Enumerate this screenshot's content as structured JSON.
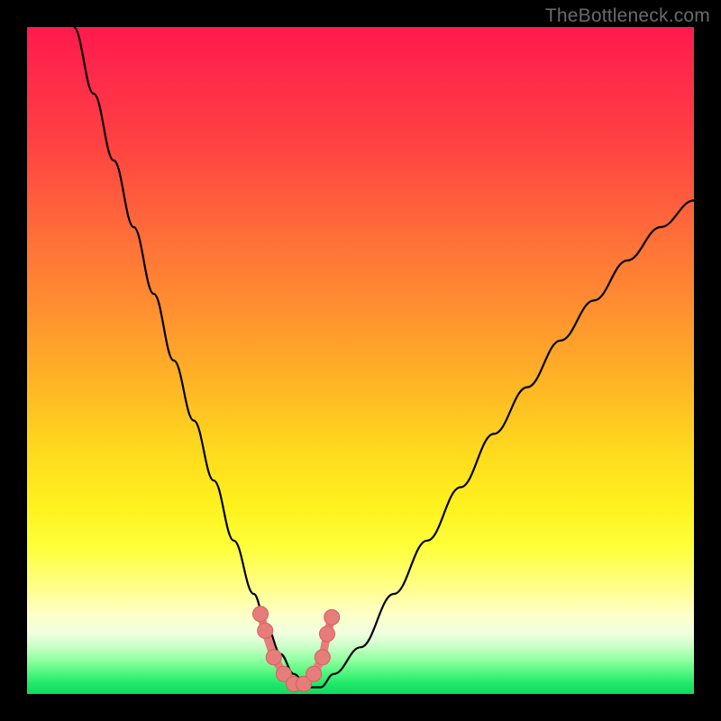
{
  "watermark": "TheBottleneck.com",
  "colors": {
    "curve_stroke": "#000000",
    "marker_fill": "#e77d7a",
    "marker_stroke": "#d45f5c",
    "frame_bg": "#000000"
  },
  "chart_data": {
    "type": "line",
    "title": "",
    "xlabel": "",
    "ylabel": "",
    "xlim": [
      0,
      100
    ],
    "ylim": [
      0,
      100
    ],
    "grid": false,
    "legend": false,
    "note": "Bottleneck-style V curve; y represents mismatch %. Background gradient encodes severity (red=high ~100, green=low ~0). Values are estimated from pixel positions; no numeric axis labels are rendered.",
    "series": [
      {
        "name": "bottleneck-curve",
        "x": [
          7,
          10,
          13,
          16,
          19,
          22,
          25,
          28,
          31,
          34,
          36,
          38,
          40,
          42,
          44,
          46,
          50,
          55,
          60,
          65,
          70,
          75,
          80,
          85,
          90,
          95,
          100
        ],
        "y": [
          100,
          90,
          80,
          70,
          60,
          50,
          41,
          32,
          23,
          15,
          10,
          6,
          3,
          1,
          1,
          3,
          7,
          15,
          23,
          31,
          39,
          46,
          53,
          59,
          65,
          70,
          74
        ]
      }
    ],
    "markers": {
      "name": "highlighted-points",
      "x": [
        35.0,
        35.7,
        37.0,
        38.5,
        40.0,
        41.5,
        43.0,
        44.3,
        45.0,
        45.7
      ],
      "y": [
        12.0,
        9.5,
        5.5,
        3.0,
        1.5,
        1.5,
        3.0,
        5.5,
        9.0,
        11.5
      ]
    }
  }
}
